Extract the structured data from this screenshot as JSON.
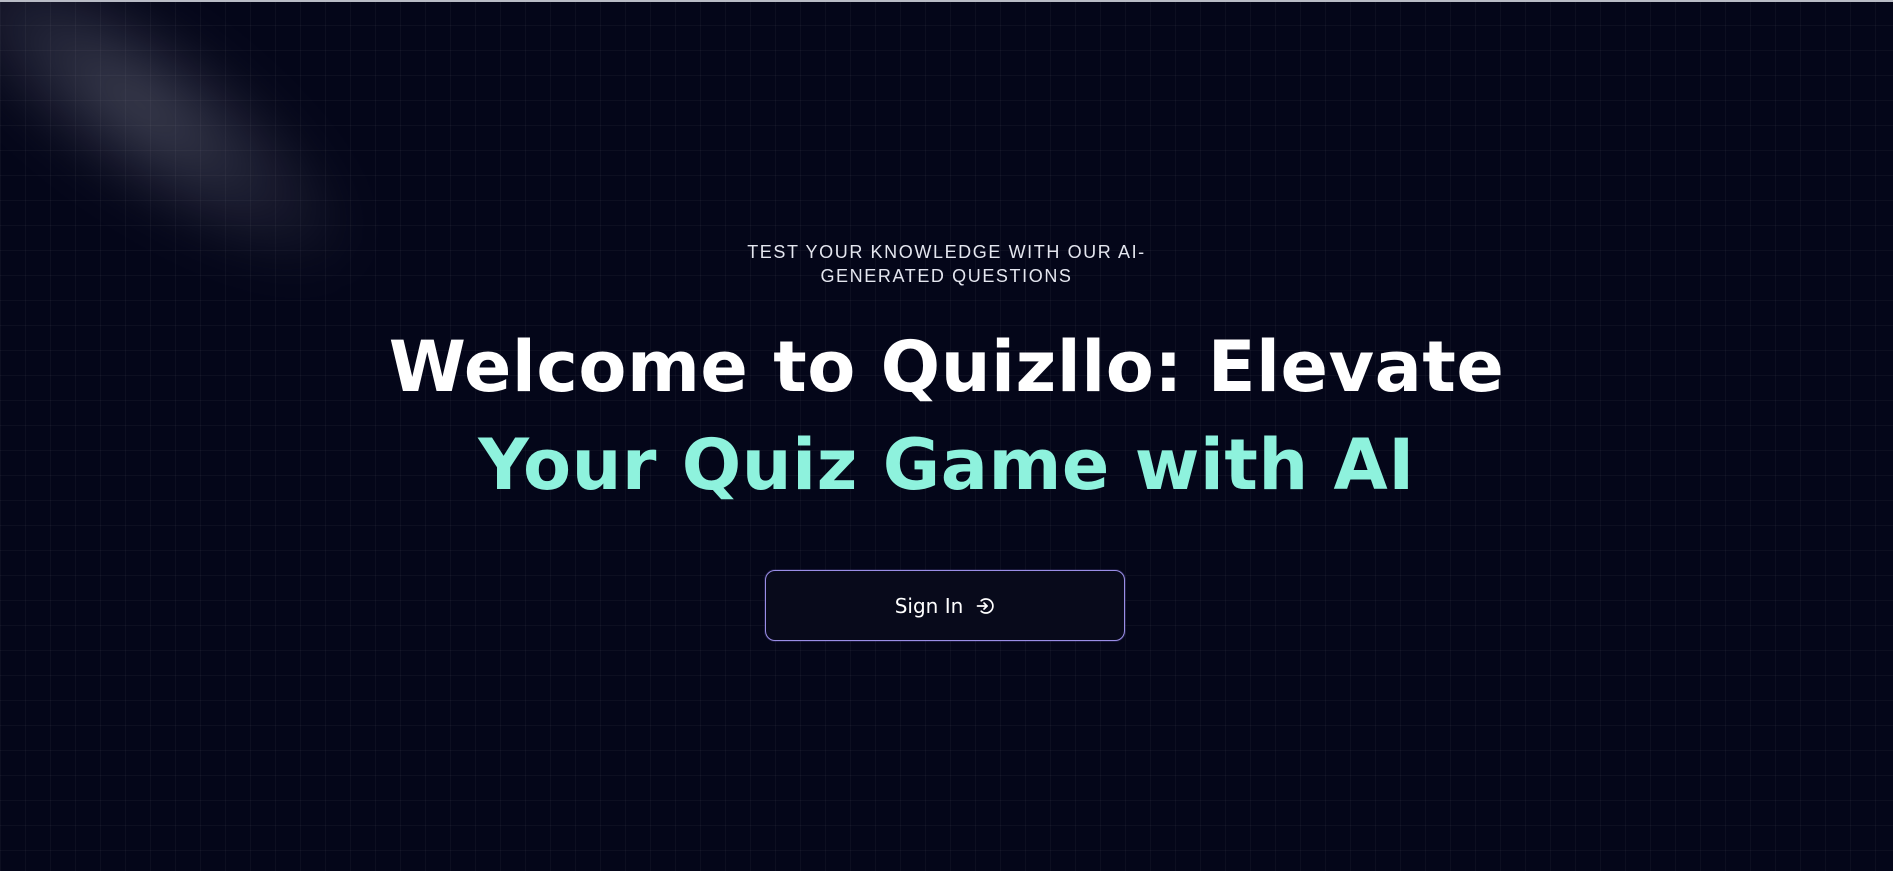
{
  "hero": {
    "eyebrow_line_1": "TEST YOUR KNOWLEDGE WITH OUR AI-",
    "eyebrow_line_2": "GENERATED QUESTIONS",
    "headline_line_1": "Welcome to Quizllo: Elevate",
    "headline_line_2": "Your Quiz Game with AI"
  },
  "signin_button": {
    "label": "Sign In",
    "icon": "sign-in-icon"
  },
  "colors": {
    "background": "#040619",
    "headline": "#ffffff",
    "accent": "#8ef2dd",
    "button_border": "#9a8ee6"
  }
}
